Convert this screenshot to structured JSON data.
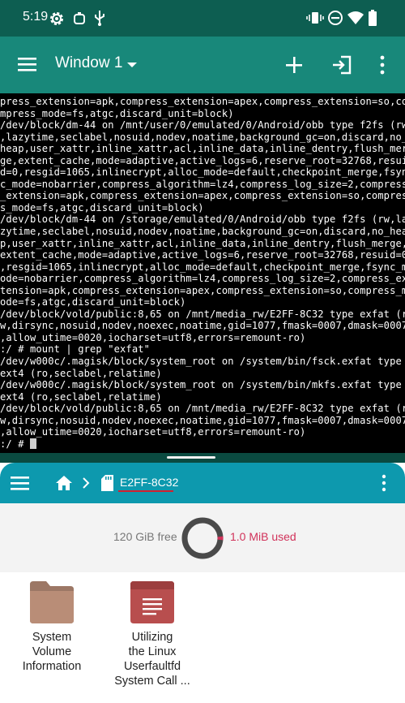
{
  "status_bar": {
    "time": "5:19"
  },
  "terminal_app": {
    "window_title": "Window 1",
    "output_lines": [
      "press_extension=apk,compress_extension=apex,compress_extension=so,co",
      "mpress_mode=fs,atgc,discard_unit=block)",
      "/dev/block/dm-44 on /mnt/user/0/emulated/0/Android/obb type f2fs (rw",
      ",lazytime,seclabel,nosuid,nodev,noatime,background_gc=on,discard,no_",
      "heap,user_xattr,inline_xattr,acl,inline_data,inline_dentry,flush_mer",
      "ge,extent_cache,mode=adaptive,active_logs=6,reserve_root=32768,resui",
      "d=0,resgid=1065,inlinecrypt,alloc_mode=default,checkpoint_merge,fsyn",
      "c_mode=nobarrier,compress_algorithm=lz4,compress_log_size=2,compress",
      "_extension=apk,compress_extension=apex,compress_extension=so,compres",
      "s_mode=fs,atgc,discard_unit=block)",
      "/dev/block/dm-44 on /storage/emulated/0/Android/obb type f2fs (rw,la",
      "zytime,seclabel,nosuid,nodev,noatime,background_gc=on,discard,no_hea",
      "p,user_xattr,inline_xattr,acl,inline_data,inline_dentry,flush_merge,",
      "extent_cache,mode=adaptive,active_logs=6,reserve_root=32768,resuid=0",
      ",resgid=1065,inlinecrypt,alloc_mode=default,checkpoint_merge,fsync_m",
      "ode=nobarrier,compress_algorithm=lz4,compress_log_size=2,compress_ex",
      "tension=apk,compress_extension=apex,compress_extension=so,compress_m",
      "ode=fs,atgc,discard_unit=block)",
      "/dev/block/vold/public:8,65 on /mnt/media_rw/E2FF-8C32 type exfat (r",
      "w,dirsync,nosuid,nodev,noexec,noatime,gid=1077,fmask=0007,dmask=0007",
      ",allow_utime=0020,iocharset=utf8,errors=remount-ro)",
      ":/ # mount | grep \"exfat\"",
      "/dev/w000c/.magisk/block/system_root on /system/bin/fsck.exfat type",
      "ext4 (ro,seclabel,relatime)",
      "/dev/w000c/.magisk/block/system_root on /system/bin/mkfs.exfat type",
      "ext4 (ro,seclabel,relatime)",
      "/dev/block/vold/public:8,65 on /mnt/media_rw/E2FF-8C32 type exfat (r",
      "w,dirsync,nosuid,nodev,noexec,noatime,gid=1077,fmask=0007,dmask=0007",
      ",allow_utime=0020,iocharset=utf8,errors=remount-ro)",
      ":/ # "
    ]
  },
  "file_manager": {
    "breadcrumb_current": "E2FF-8C32",
    "storage_free": "120 GiB free",
    "storage_used": "1.0 MiB used",
    "storage_used_fraction": 0.01,
    "files": [
      {
        "name": "System\nVolume\nInformation",
        "type": "folder"
      },
      {
        "name": "Utilizing\nthe Linux\nUserfaultfd\nSystem Call ...",
        "type": "document"
      }
    ]
  },
  "colors": {
    "status_bar": "#0d5e51",
    "terminal_toolbar": "#18887a",
    "terminal_bg": "#000000",
    "file_manager_toolbar": "#0d99ae",
    "used_accent": "#d1325a",
    "underline_red": "#d22030"
  },
  "icons": {
    "status_bar": [
      "gear-icon",
      "robot-icon",
      "usb-icon",
      "vibrate-icon",
      "do-not-disturb-icon",
      "wifi-icon",
      "battery-icon"
    ],
    "terminal_toolbar": [
      "hamburger-menu-icon",
      "dropdown-arrow-icon",
      "add-icon",
      "enter-icon",
      "more-vert-icon"
    ],
    "file_manager_toolbar": [
      "hamburger-menu-icon",
      "home-icon",
      "chevron-right-icon",
      "sd-card-icon",
      "more-vert-icon"
    ]
  }
}
